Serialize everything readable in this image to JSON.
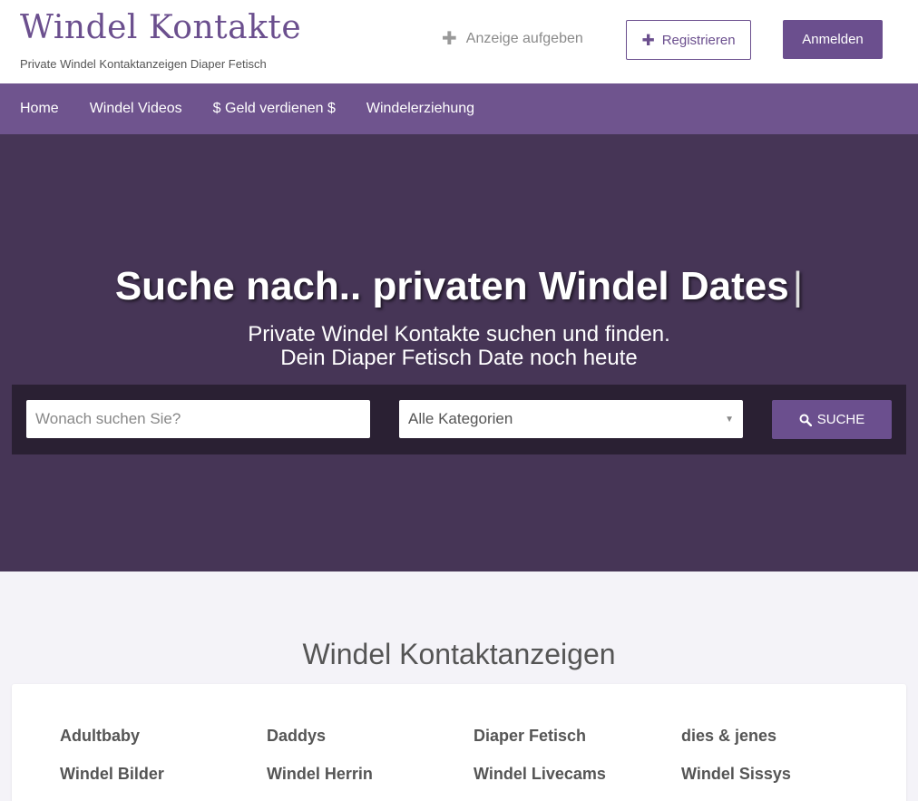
{
  "header": {
    "site_title": "Windel Kontakte",
    "site_subtitle": "Private Windel Kontaktanzeigen Diaper Fetisch",
    "post_ad_label": "Anzeige aufgeben",
    "register_label": "Registrieren",
    "login_label": "Anmelden"
  },
  "nav": {
    "items": [
      {
        "label": "Home"
      },
      {
        "label": "Windel Videos"
      },
      {
        "label": "$ Geld verdienen $"
      },
      {
        "label": "Windelerziehung"
      }
    ]
  },
  "hero": {
    "title": "Suche nach.. privaten Windel Dates",
    "caret": "|",
    "subtitle_line1": "Private Windel Kontakte suchen und finden.",
    "subtitle_line2": "Dein Diaper Fetisch Date noch heute"
  },
  "search": {
    "placeholder": "Wonach suchen Sie?",
    "category_selected": "Alle Kategorien",
    "button_label": "SUCHE"
  },
  "listings": {
    "title": "Windel Kontaktanzeigen",
    "categories": [
      "Adultbaby",
      "Daddys",
      "Diaper Fetisch",
      "dies & jenes",
      "Windel Bilder",
      "Windel Herrin",
      "Windel Livecams",
      "Windel Sissys"
    ]
  },
  "colors": {
    "brand": "#6b4f8e",
    "nav_bg": "#6f548e",
    "hero_bg": "#463556",
    "search_bar_bg": "#2a2033"
  },
  "icons": {
    "post_ad": "plus-icon",
    "register": "plus-icon",
    "search": "search-icon",
    "select": "chevron-down-icon"
  }
}
